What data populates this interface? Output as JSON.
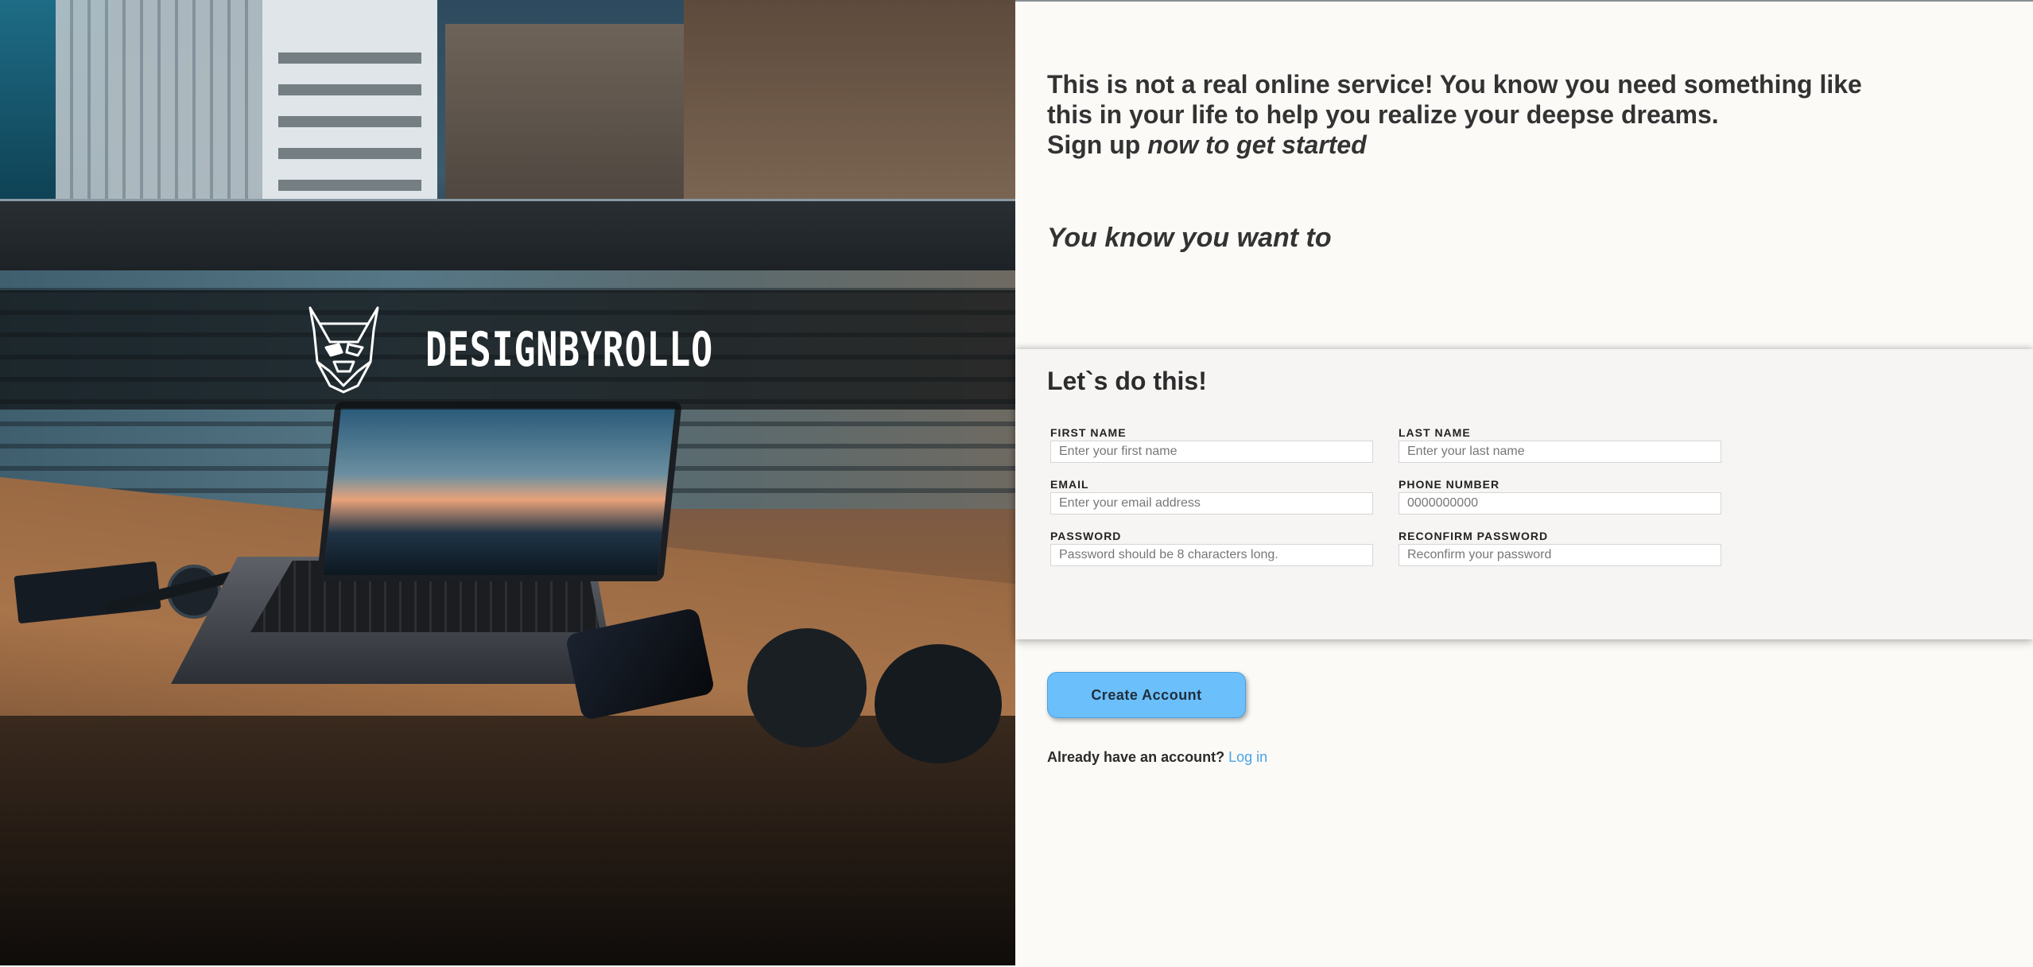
{
  "brand": {
    "name": "DESIGNBYROLLO",
    "logo_icon": "dog-head-logo-icon"
  },
  "intro": {
    "headline": "This is not a real online service! You know you need something like this in your life to help you realize your deepse dreams.",
    "signup_prefix": "Sign up ",
    "signup_italic": "now to get started",
    "tagline": "You know you want to"
  },
  "form": {
    "title": "Let`s do this!",
    "fields": {
      "first_name": {
        "label": "FIRST NAME",
        "placeholder": "Enter your first name",
        "value": ""
      },
      "last_name": {
        "label": "LAST NAME",
        "placeholder": "Enter your last name",
        "value": ""
      },
      "email": {
        "label": "EMAIL",
        "placeholder": "Enter your email address",
        "value": ""
      },
      "phone": {
        "label": "PHONE NUMBER",
        "placeholder": "0000000000",
        "value": ""
      },
      "password": {
        "label": "PASSWORD",
        "placeholder": "Password should be 8 characters long.",
        "value": ""
      },
      "confirm_password": {
        "label": "RECONFIRM PASSWORD",
        "placeholder": "Reconfirm your password",
        "value": ""
      }
    }
  },
  "actions": {
    "create_label": "Create Account",
    "login_prompt": "Already have an account?",
    "login_link": "Log in"
  },
  "colors": {
    "page_bg": "#fbfaf7",
    "form_bg": "#f6f5f3",
    "button_bg": "#6bbffb",
    "link": "#4aa3e6",
    "brand_band": "#0f1214"
  }
}
